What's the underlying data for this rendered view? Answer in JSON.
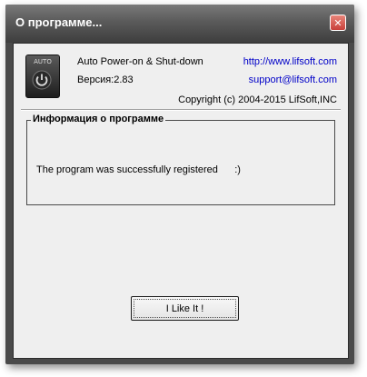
{
  "window": {
    "title": "О программе...",
    "close_glyph": "✕"
  },
  "app": {
    "icon_name": "auto-power-icon",
    "icon_label": "AUTO",
    "product_name": "Auto Power-on & Shut-down",
    "version": "Версия:2.83",
    "website": "http://www.lifsoft.com",
    "support_email": "support@lifsoft.com",
    "copyright": "Copyright (c) 2004-2015 LifSoft,INC"
  },
  "info_group": {
    "title": "Информация о программе",
    "status": "The program was successfully registered      :)"
  },
  "buttons": {
    "like_label": "I Like It  !"
  },
  "colors": {
    "link": "#0000c8",
    "frame": "#4a4a4a",
    "client_bg": "#efefef",
    "close_button": "#c8403a"
  }
}
